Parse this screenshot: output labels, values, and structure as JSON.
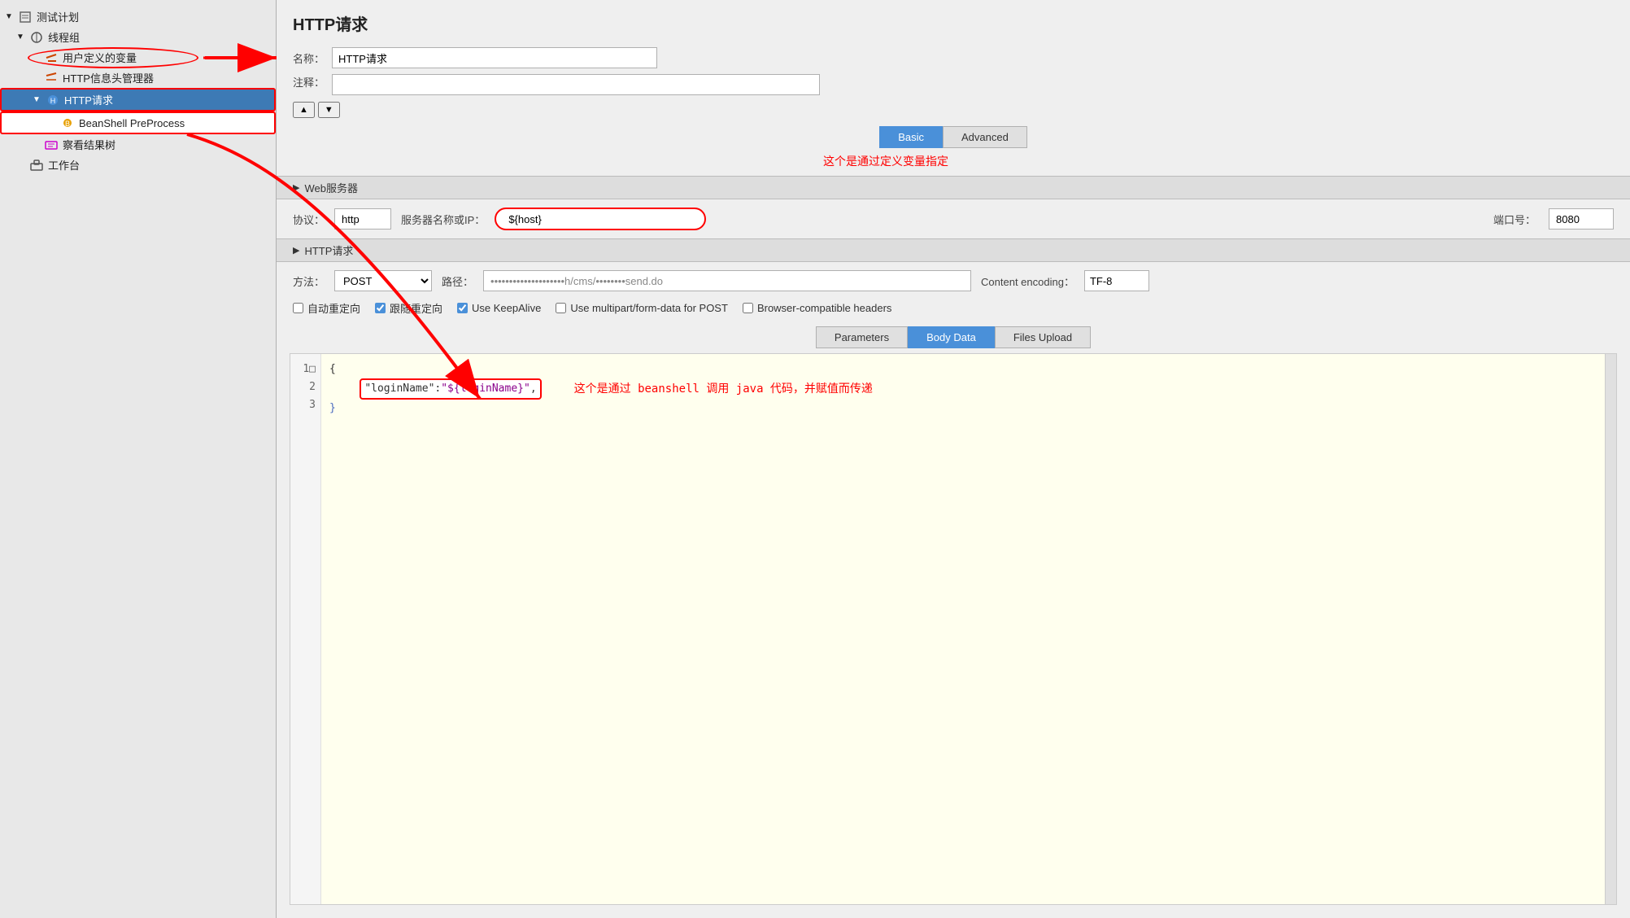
{
  "sidebar": {
    "title": "测试计划",
    "items": [
      {
        "id": "test-plan",
        "label": "测试计划",
        "indent": 0,
        "type": "plan",
        "arrow": "▼"
      },
      {
        "id": "thread-group",
        "label": "线程组",
        "indent": 1,
        "type": "thread",
        "arrow": "▼"
      },
      {
        "id": "user-vars",
        "label": "用户定义的变量",
        "indent": 2,
        "type": "user-vars",
        "arrow": ""
      },
      {
        "id": "http-header",
        "label": "HTTP信息头管理器",
        "indent": 2,
        "type": "header",
        "arrow": ""
      },
      {
        "id": "http-request",
        "label": "HTTP请求",
        "indent": 2,
        "type": "request",
        "arrow": "▼",
        "selected": true
      },
      {
        "id": "beanshell",
        "label": "BeanShell PreProcess",
        "indent": 3,
        "type": "beanshell",
        "arrow": ""
      },
      {
        "id": "results-tree",
        "label": "察看结果树",
        "indent": 2,
        "type": "results",
        "arrow": ""
      },
      {
        "id": "workbench",
        "label": "工作台",
        "indent": 1,
        "type": "workbench",
        "arrow": ""
      }
    ]
  },
  "panel": {
    "title": "HTTP请求",
    "name_label": "名称：",
    "name_value": "HTTP请求",
    "comment_label": "注释：",
    "tabs": {
      "basic": "Basic",
      "advanced": "Advanced"
    },
    "basic_active": true,
    "annotation_basic": "这个是通过定义变量指定",
    "web_server": {
      "section": "Web服务器",
      "protocol_label": "协议：",
      "protocol_value": "http",
      "server_label": "服务器名称或IP：",
      "server_value": "${host}",
      "port_label": "端口号：",
      "port_value": "8080"
    },
    "http_request": {
      "section": "HTTP请求",
      "method_label": "方法：",
      "method_value": "POST",
      "path_label": "路径：",
      "path_value": "••••••••••••••••••••h/cms/••••••••send.do",
      "encoding_label": "Content encoding：",
      "encoding_value": "TF-8"
    },
    "checkboxes": [
      {
        "id": "auto-redirect",
        "label": "自动重定向",
        "checked": false
      },
      {
        "id": "follow-redirect",
        "label": "跟随重定向",
        "checked": true
      },
      {
        "id": "keep-alive",
        "label": "Use KeepAlive",
        "checked": true
      },
      {
        "id": "multipart",
        "label": "Use multipart/form-data for POST",
        "checked": false
      },
      {
        "id": "browser-headers",
        "label": "Browser-compatible headers",
        "checked": false
      }
    ],
    "sub_tabs": {
      "parameters": "Parameters",
      "body_data": "Body Data",
      "files_upload": "Files Upload",
      "active": "body_data"
    },
    "code": {
      "lines": [
        {
          "num": "1",
          "content": "{",
          "type": "brace"
        },
        {
          "num": "2",
          "content": "\"loginName\":\"${loginName}\",",
          "type": "pair"
        },
        {
          "num": "3",
          "content": "}",
          "type": "brace"
        }
      ],
      "annotation": "这个是通过 beanshell 调用 java 代码，并赋值而传递"
    }
  }
}
